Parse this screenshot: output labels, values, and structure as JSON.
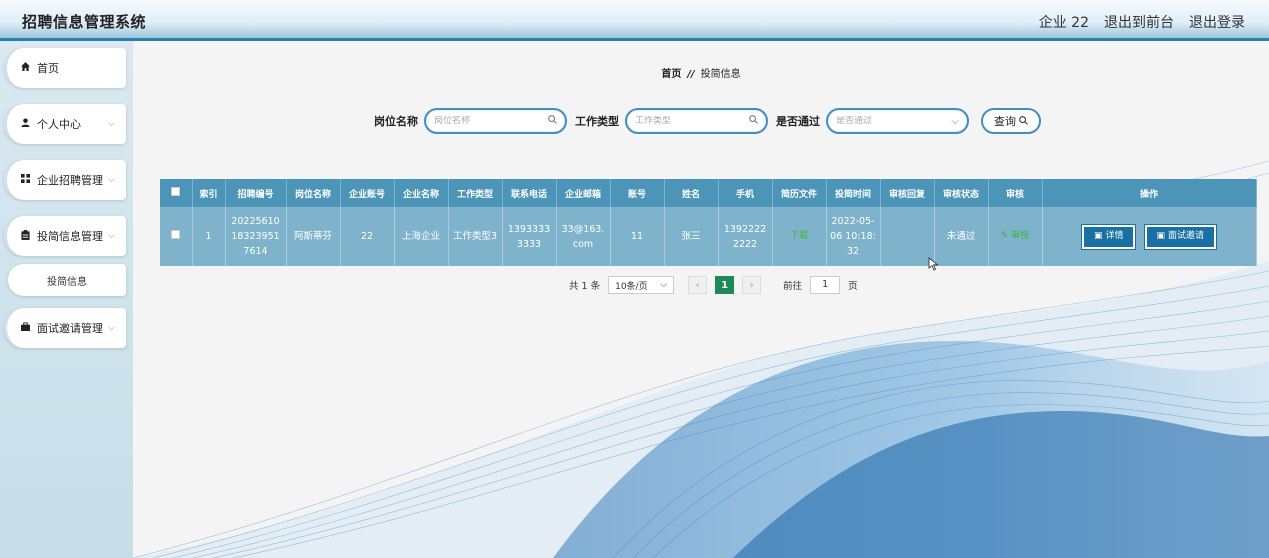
{
  "header": {
    "title": "招聘信息管理系统",
    "user": "企业 22",
    "back_to_front": "退出到前台",
    "logout": "退出登录"
  },
  "sidebar": {
    "items": [
      {
        "label": "首页",
        "icon": "home-icon"
      },
      {
        "label": "个人中心",
        "icon": "user-icon"
      },
      {
        "label": "企业招聘管理",
        "icon": "grid-icon"
      },
      {
        "label": "投简信息管理",
        "icon": "clipboard-icon"
      },
      {
        "label": "面试邀请管理",
        "icon": "briefcase-icon"
      }
    ],
    "sub_item": "投简信息"
  },
  "breadcrumb": {
    "home": "首页",
    "sep": "//",
    "current": "投简信息"
  },
  "search": {
    "job_label": "岗位名称",
    "job_placeholder": "岗位名称",
    "type_label": "工作类型",
    "type_placeholder": "工作类型",
    "pass_label": "是否通过",
    "pass_placeholder": "是否通过",
    "query_label": "查询"
  },
  "table": {
    "headers": [
      "索引",
      "招聘编号",
      "岗位名称",
      "企业账号",
      "企业名称",
      "工作类型",
      "联系电话",
      "企业邮箱",
      "账号",
      "姓名",
      "手机",
      "简历文件",
      "投简时间",
      "审核回复",
      "审核状态",
      "审核",
      "操作"
    ],
    "rows": [
      {
        "index": "1",
        "recruit_no": "2022561018323951 7614",
        "job": "阿斯蒂芬",
        "company_account": "22",
        "company_name": "上海企业",
        "work_type": "工作类型3",
        "phone": "13933333333",
        "email": "33@163.com",
        "account": "11",
        "name": "张三",
        "mobile": "13922222222",
        "resume": "下载",
        "time": "2022-05-06 10:18:32",
        "reply": "",
        "status": "未通过",
        "audit": "审核",
        "detail_btn": "详情",
        "invite_btn": "面试邀请"
      }
    ]
  },
  "pager": {
    "total": "共 1 条",
    "page_size": "10条/页",
    "current": "1",
    "goto_prefix": "前往",
    "goto_value": "1",
    "goto_suffix": "页"
  },
  "colors": {
    "accent": "#2e7fb0",
    "table_header": "#4d95b8",
    "table_row": "#7fb3cc",
    "button": "#1a6fa3",
    "page_active": "#1e8a58"
  }
}
